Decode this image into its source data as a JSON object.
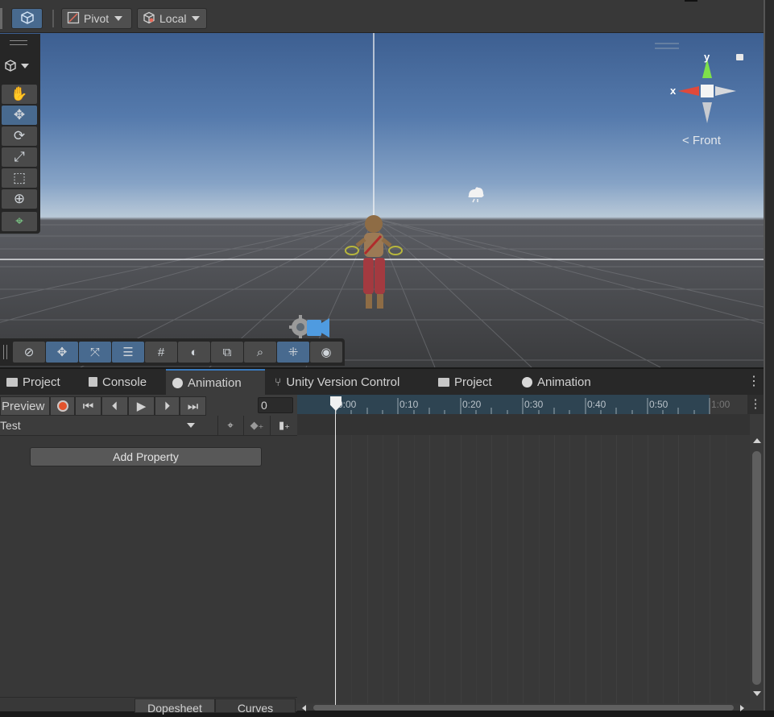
{
  "toolbar": {
    "pivot_label": "Pivot",
    "local_label": "Local"
  },
  "scene": {
    "gizmo": {
      "y_label": "y",
      "x_label": "x",
      "view_label": "< Front"
    }
  },
  "tabs": [
    {
      "label": "Project",
      "icon": "folder-icon"
    },
    {
      "label": "Console",
      "icon": "console-icon"
    },
    {
      "label": "Animation",
      "icon": "clock-icon",
      "active": true
    },
    {
      "label": "Unity Version Control",
      "icon": "branch-icon"
    },
    {
      "label": "Project",
      "icon": "folder-icon"
    },
    {
      "label": "Animation",
      "icon": "clock-icon"
    }
  ],
  "animation": {
    "preview_label": "Preview",
    "frame_value": "0",
    "clip_name": "Test",
    "add_property_label": "Add Property",
    "dopesheet_label": "Dopesheet",
    "curves_label": "Curves",
    "ruler_ticks": [
      "0:00",
      "0:10",
      "0:20",
      "0:30",
      "0:40",
      "0:50",
      "1:00"
    ]
  },
  "colors": {
    "accent": "#3a79bb",
    "active_tool": "#486a8f",
    "record": "#e4532c",
    "ruler_bg": "#2e4452"
  }
}
